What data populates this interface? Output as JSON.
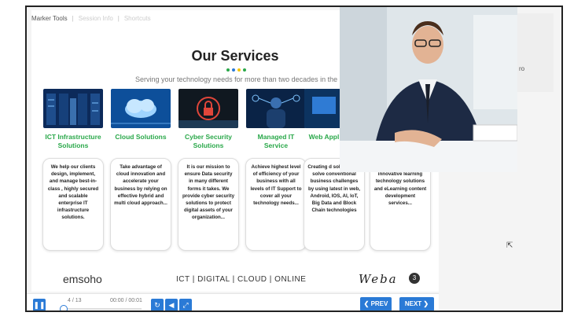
{
  "marker_tabs": [
    "Marker Tools",
    "Session Info",
    "Shortcuts"
  ],
  "slide": {
    "title": "Our Services",
    "subtitle": "Serving your technology needs for more than two decades in the U.A.E",
    "dots": [
      "#2aa84a",
      "#2a7ad6",
      "#f1c40f",
      "#2aa84a"
    ],
    "cards": [
      {
        "title": "ICT Infrastructure Solutions",
        "text": "We help our clients design, implement, and manage best-in-class , highly secured and scalable enterprise IT infrastructure solutions."
      },
      {
        "title": "Cloud Solutions",
        "text": "Take advantage of cloud innovation and accelerate your business by relying on effective hybrid and multi cloud approach..."
      },
      {
        "title": "Cyber Security Solutions",
        "text": "It is our mission to ensure Data security in many different forms it takes. We provide cyber security solutions to protect digital assets of your organization..."
      },
      {
        "title": "Managed IT Service",
        "text": "Achieve highest level of efficiency of your business with all levels of IT Support to cover all your technology needs..."
      },
      {
        "title": "Web Appl Soluti",
        "text": "Creating d solutions to solve conventional business challenges by using latest in web, Android, IOS, AI, IoT, Big Data and Block Chain technologies"
      },
      {
        "title": "",
        "text": "in providing most innovative learning technology solutions and eLearning content development services..."
      }
    ],
    "footer_logo": "emsoho",
    "footer_tagline": "ICT | DIGITAL | CLOUD | ONLINE",
    "brand": "Weba",
    "brand_badge": "3"
  },
  "side_panel_text": "ro",
  "player": {
    "slide_counter": "4 / 13",
    "time": "00:00 / 00:01",
    "prev_label": "❮ PREV",
    "next_label": "NEXT ❯"
  }
}
